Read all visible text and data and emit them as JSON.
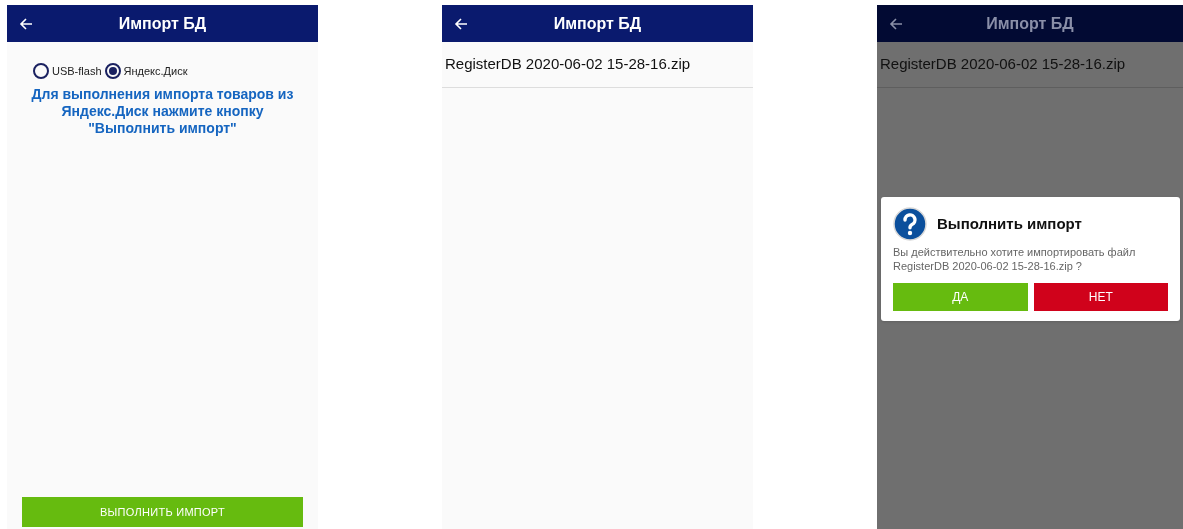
{
  "screens": [
    {
      "kind": "radio_form",
      "title": "Импорт БД",
      "dimmed": false,
      "options": [
        {
          "label": "USB-flash",
          "selected": false
        },
        {
          "label": "Яндекс.Диск",
          "selected": true
        }
      ],
      "message": "Для выполнения импорта товаров из Яндекс.Диск нажмите кнопку \"Выполнить импорт\"",
      "button": "ВЫПОЛНИТЬ ИМПОРТ"
    },
    {
      "kind": "file_list",
      "title": "Импорт БД",
      "dimmed": false,
      "files": [
        "RegisterDB 2020-06-02 15-28-16.zip"
      ]
    },
    {
      "kind": "file_list",
      "title": "Импорт БД",
      "dimmed": true,
      "files": [
        "RegisterDB 2020-06-02 15-28-16.zip"
      ],
      "dialog": {
        "title": "Выполнить импорт",
        "message": "Вы действительно хотите импортировать файл RegisterDB 2020-06-02 15-28-16.zip ?",
        "buttons": [
          {
            "label": "ДА",
            "kind": "confirm"
          },
          {
            "label": "НЕТ",
            "kind": "cancel"
          }
        ]
      }
    }
  ]
}
